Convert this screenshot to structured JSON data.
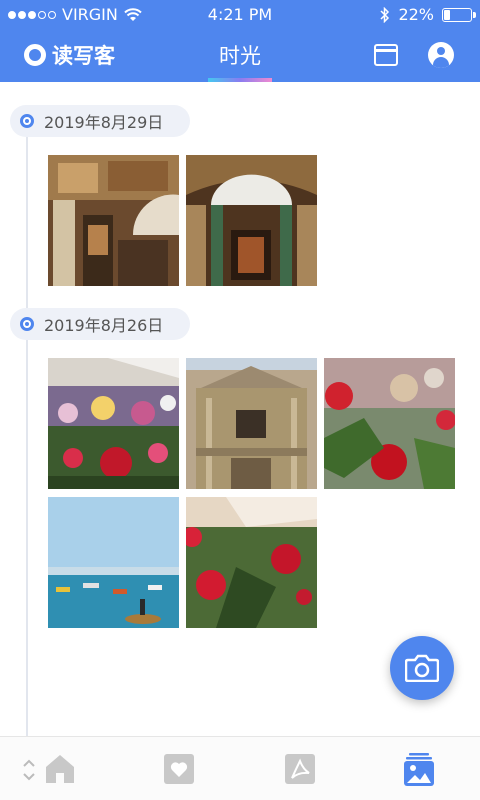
{
  "status_bar": {
    "carrier": "VIRGIN",
    "time": "4:21 PM",
    "battery": "22%",
    "battery_level": 0.22
  },
  "header": {
    "brand": "读写客",
    "title": "时光"
  },
  "timeline": {
    "groups": [
      {
        "date": "2019年8月29日",
        "photos": [
          "church-interior-photo",
          "church-altar-photo"
        ]
      },
      {
        "date": "2019年8月26日",
        "photos": [
          "flower-market-photo",
          "church-facade-photo",
          "red-roses-photo",
          "harbor-boats-photo",
          "market-roses-photo"
        ]
      }
    ]
  },
  "colors": {
    "accent": "#4f86ee",
    "tab_inactive": "#c8c8c8"
  },
  "icons": {
    "calendar": "calendar-icon",
    "profile": "user-icon",
    "camera": "camera-icon",
    "home": "home-icon",
    "favorites": "heart-icon",
    "pdf": "pdf-icon",
    "gallery": "gallery-icon"
  }
}
